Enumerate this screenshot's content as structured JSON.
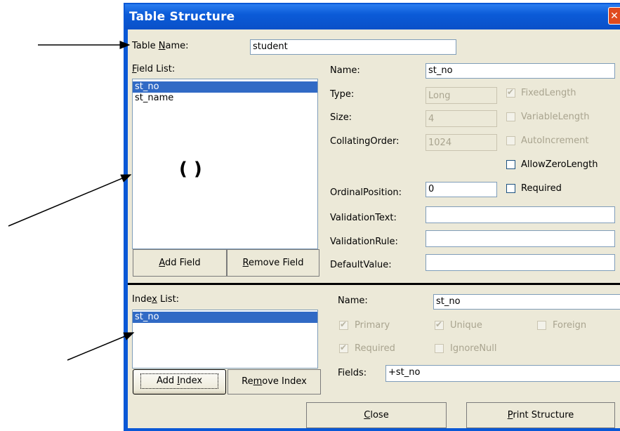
{
  "window": {
    "title": "Table Structure",
    "close_glyph": "✕"
  },
  "table_name": {
    "label_pre": "Table ",
    "label_key": "N",
    "label_post": "ame:",
    "value": "student"
  },
  "field_list": {
    "label_key": "F",
    "label_post": "ield List:",
    "items": [
      "st_no",
      "st_name"
    ],
    "selected_index": 0,
    "annotation": "( )"
  },
  "field_props": {
    "name_label": "Name:",
    "name_value": "st_no",
    "type_label": "Type:",
    "type_value": "Long",
    "size_label": "Size:",
    "size_value": "4",
    "collating_label": "CollatingOrder:",
    "collating_value": "1024",
    "ordinal_label": "OrdinalPosition:",
    "ordinal_value": "0",
    "validation_text_label": "ValidationText:",
    "validation_text_value": "",
    "validation_rule_label": "ValidationRule:",
    "validation_rule_value": "",
    "default_value_label": "DefaultValue:",
    "default_value_value": ""
  },
  "field_checks": {
    "fixed_length": {
      "label": "FixedLength",
      "checked": true,
      "enabled": false
    },
    "variable_length": {
      "label": "VariableLength",
      "checked": false,
      "enabled": false
    },
    "auto_increment": {
      "label": "AutoIncrement",
      "checked": false,
      "enabled": false
    },
    "allow_zero_length": {
      "label": "AllowZeroLength",
      "checked": false,
      "enabled": true
    },
    "required": {
      "label": "Required",
      "checked": false,
      "enabled": true
    }
  },
  "field_buttons": {
    "add_key": "A",
    "add_post": "dd Field",
    "remove_key": "R",
    "remove_post": "emove Field"
  },
  "index_list": {
    "label_pre": "Inde",
    "label_key": "x",
    "label_post": " List:",
    "items": [
      "st_no"
    ],
    "selected_index": 0
  },
  "index_props": {
    "name_label": "Name:",
    "name_value": "st_no",
    "fields_label": "Fields:",
    "fields_value": "+st_no"
  },
  "index_checks": {
    "primary": {
      "label": "Primary",
      "checked": true,
      "enabled": false
    },
    "unique": {
      "label": "Unique",
      "checked": true,
      "enabled": false
    },
    "foreign": {
      "label": "Foreign",
      "checked": false,
      "enabled": false
    },
    "required": {
      "label": "Required",
      "checked": true,
      "enabled": false
    },
    "ignore_null": {
      "label": "IgnoreNull",
      "checked": false,
      "enabled": false
    }
  },
  "index_buttons": {
    "add_pre": "Add ",
    "add_key": "I",
    "add_post": "ndex",
    "remove_pre": "Re",
    "remove_key": "m",
    "remove_post": "ove Index"
  },
  "footer": {
    "close_key": "C",
    "close_post": "lose",
    "print_key": "P",
    "print_post": "rint Structure"
  }
}
